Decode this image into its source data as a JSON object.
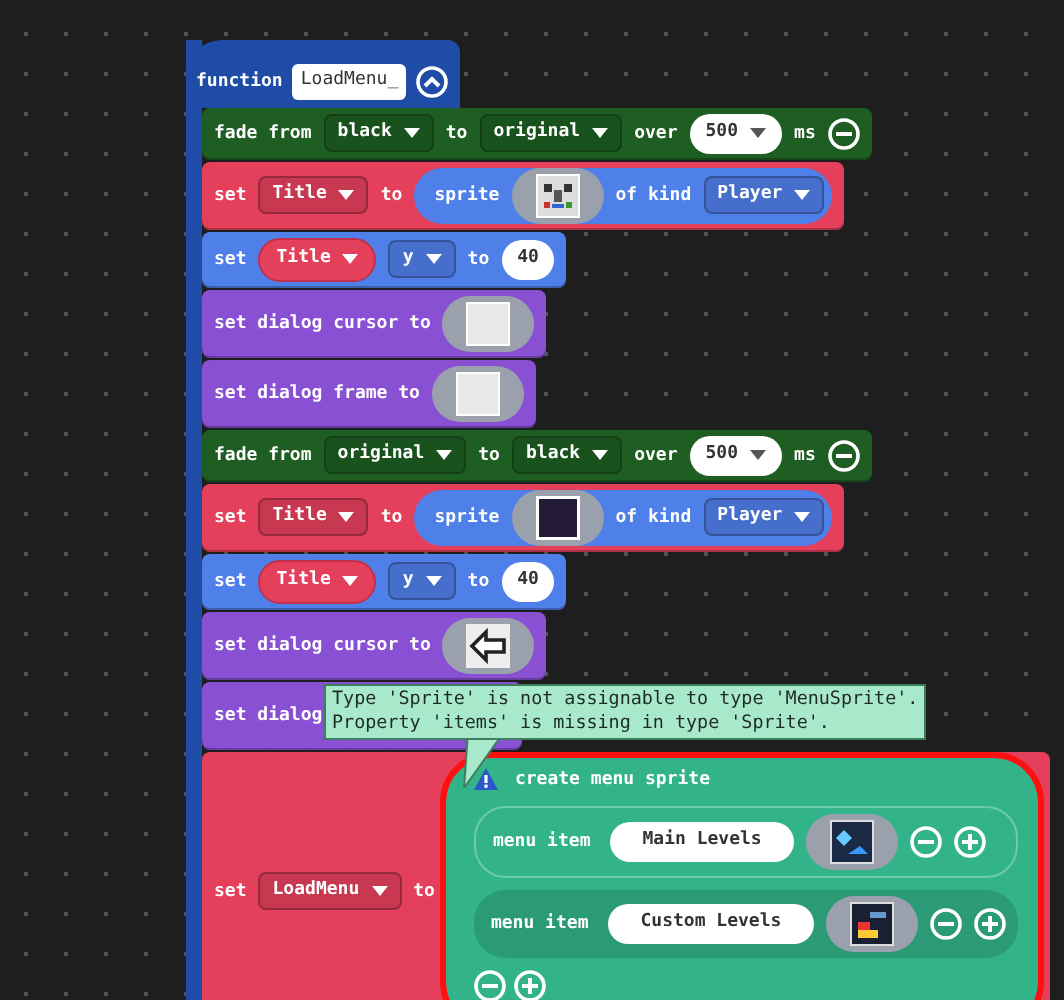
{
  "function": {
    "keyword": "function",
    "name": "LoadMenu_"
  },
  "blocks": [
    {
      "kind": "fade",
      "segments": [
        {
          "kind": "label",
          "text": "fade from"
        },
        {
          "kind": "dropdown",
          "text": "black"
        },
        {
          "kind": "label",
          "text": "to"
        },
        {
          "kind": "dropdown",
          "text": "original"
        },
        {
          "kind": "label",
          "text": "over"
        },
        {
          "kind": "numdropdown",
          "text": "500"
        },
        {
          "kind": "label",
          "text": "ms"
        },
        {
          "kind": "minus"
        }
      ]
    },
    {
      "kind": "set_variable",
      "segments": [
        {
          "kind": "label",
          "text": "set"
        },
        {
          "kind": "dropdown",
          "text": "Title"
        },
        {
          "kind": "label",
          "text": "to"
        },
        {
          "kind": "reporter",
          "segments": [
            {
              "kind": "label",
              "text": "sprite"
            },
            {
              "kind": "sprite"
            },
            {
              "kind": "label",
              "text": "of kind"
            },
            {
              "kind": "dropdown",
              "text": "Player"
            }
          ]
        }
      ]
    },
    {
      "kind": "set_position",
      "segments": [
        {
          "kind": "label",
          "text": "set"
        },
        {
          "kind": "variable",
          "text": "Title"
        },
        {
          "kind": "dropdown",
          "text": "y"
        },
        {
          "kind": "label",
          "text": "to"
        },
        {
          "kind": "number",
          "text": "40"
        }
      ]
    },
    {
      "kind": "dialog",
      "segments": [
        {
          "kind": "label",
          "text": "set dialog cursor to"
        },
        {
          "kind": "blank"
        }
      ]
    },
    {
      "kind": "dialog",
      "segments": [
        {
          "kind": "label",
          "text": "set dialog frame to"
        },
        {
          "kind": "blank"
        }
      ]
    },
    {
      "kind": "fade",
      "segments": [
        {
          "kind": "label",
          "text": "fade from"
        },
        {
          "kind": "dropdown",
          "text": "original"
        },
        {
          "kind": "label",
          "text": "to"
        },
        {
          "kind": "dropdown",
          "text": "black"
        },
        {
          "kind": "label",
          "text": "over"
        },
        {
          "kind": "numdropdown",
          "text": "500"
        },
        {
          "kind": "label",
          "text": "ms"
        },
        {
          "kind": "minus"
        }
      ]
    },
    {
      "kind": "set_variable",
      "segments": [
        {
          "kind": "label",
          "text": "set"
        },
        {
          "kind": "dropdown",
          "text": "Title"
        },
        {
          "kind": "label",
          "text": "to"
        },
        {
          "kind": "reporter",
          "segments": [
            {
              "kind": "label",
              "text": "sprite"
            },
            {
              "kind": "dark"
            },
            {
              "kind": "label",
              "text": "of kind"
            },
            {
              "kind": "dropdown",
              "text": "Player"
            }
          ]
        }
      ]
    },
    {
      "kind": "set_position",
      "segments": [
        {
          "kind": "label",
          "text": "set"
        },
        {
          "kind": "variable",
          "text": "Title"
        },
        {
          "kind": "dropdown",
          "text": "y"
        },
        {
          "kind": "label",
          "text": "to"
        },
        {
          "kind": "number",
          "text": "40"
        }
      ]
    },
    {
      "kind": "dialog",
      "segments": [
        {
          "kind": "label",
          "text": "set dialog cursor to"
        },
        {
          "kind": "arrow"
        }
      ]
    },
    {
      "kind": "dialog",
      "segments": [
        {
          "kind": "label",
          "text": "set dialog"
        }
      ]
    },
    {
      "kind": "set_variable",
      "segments": [
        {
          "kind": "label",
          "text": "set"
        },
        {
          "kind": "dropdown",
          "text": "LoadMenu"
        },
        {
          "kind": "label",
          "text": "to"
        },
        {
          "kind": "menu",
          "title": "create menu sprite",
          "warning": true,
          "error": true,
          "items": [
            {
              "label": "menu item",
              "value": "Main Levels",
              "kind": "map"
            },
            {
              "label": "menu item",
              "value": "Custom Levels",
              "kind": "chart"
            }
          ]
        }
      ]
    }
  ],
  "tooltip": {
    "lines": [
      "Type 'Sprite' is not assignable to type 'MenuSprite'.",
      "Property 'items' is missing in type 'Sprite'."
    ]
  }
}
